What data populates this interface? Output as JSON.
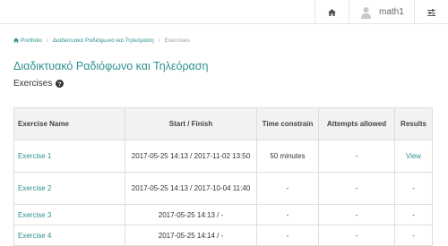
{
  "topbar": {
    "home_icon": "home-icon",
    "user_icon": "user-icon",
    "username": "math1",
    "settings_icon": "sliders-icon"
  },
  "breadcrumb": {
    "home_icon": "home-icon",
    "items": [
      "Portfolio",
      "Διαδικτυακό Ραδιόφωνο και Τηλεόραση",
      "Exercises"
    ]
  },
  "page": {
    "title": "Διαδικτυακό Ραδιόφωνο και Τηλεόραση",
    "subtitle": "Exercises",
    "help_icon": "question-circle-icon"
  },
  "table": {
    "headers": [
      "Exercise Name",
      "Start / Finish",
      "Time constrain",
      "Attempts allowed",
      "Results"
    ],
    "rows": [
      {
        "name": "Exercise 1",
        "dates": "2017-05-25 14:13 / 2017-11-02 13:50",
        "time": "50 minutes",
        "attempts": "-",
        "results": "View"
      },
      {
        "name": "Exercise 2",
        "dates": "2017-05-25 14:13 / 2017-10-04 11:40",
        "time": "-",
        "attempts": "-",
        "results": "-"
      },
      {
        "name": "Exercise 3",
        "dates": "2017-05-25 14:13 / -",
        "time": "-",
        "attempts": "-",
        "results": "-"
      },
      {
        "name": "Exercise 4",
        "dates": "2017-05-25 14:14 / -",
        "time": "-",
        "attempts": "-",
        "results": "-"
      }
    ]
  },
  "colors": {
    "accent": "#2f8f8f",
    "header_bg": "#f2f2f2",
    "border": "#dddddd"
  }
}
